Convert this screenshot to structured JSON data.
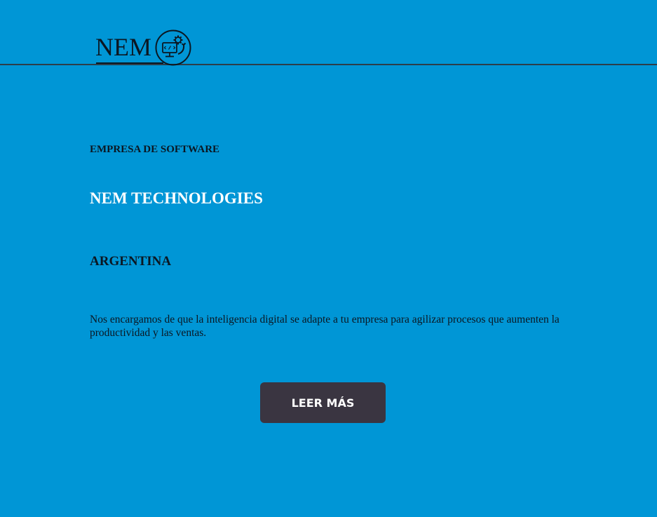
{
  "header": {
    "logo_text": "NEM"
  },
  "hero": {
    "subtitle": "EMPRESA DE SOFTWARE",
    "title": "NEM TECHNOLOGIES",
    "country": "ARGENTINA",
    "description": "Nos encargamos de que la inteligencia digital se adapte a tu empresa para agilizar procesos que aumenten la productividad y las ventas.",
    "button_label": "LEER MÁS"
  },
  "colors": {
    "background": "#0096d6",
    "button": "#3a3541",
    "title": "#ffffff",
    "text": "#0b1722"
  },
  "icons": {
    "logo_emblem": "computer-gear-icon"
  }
}
